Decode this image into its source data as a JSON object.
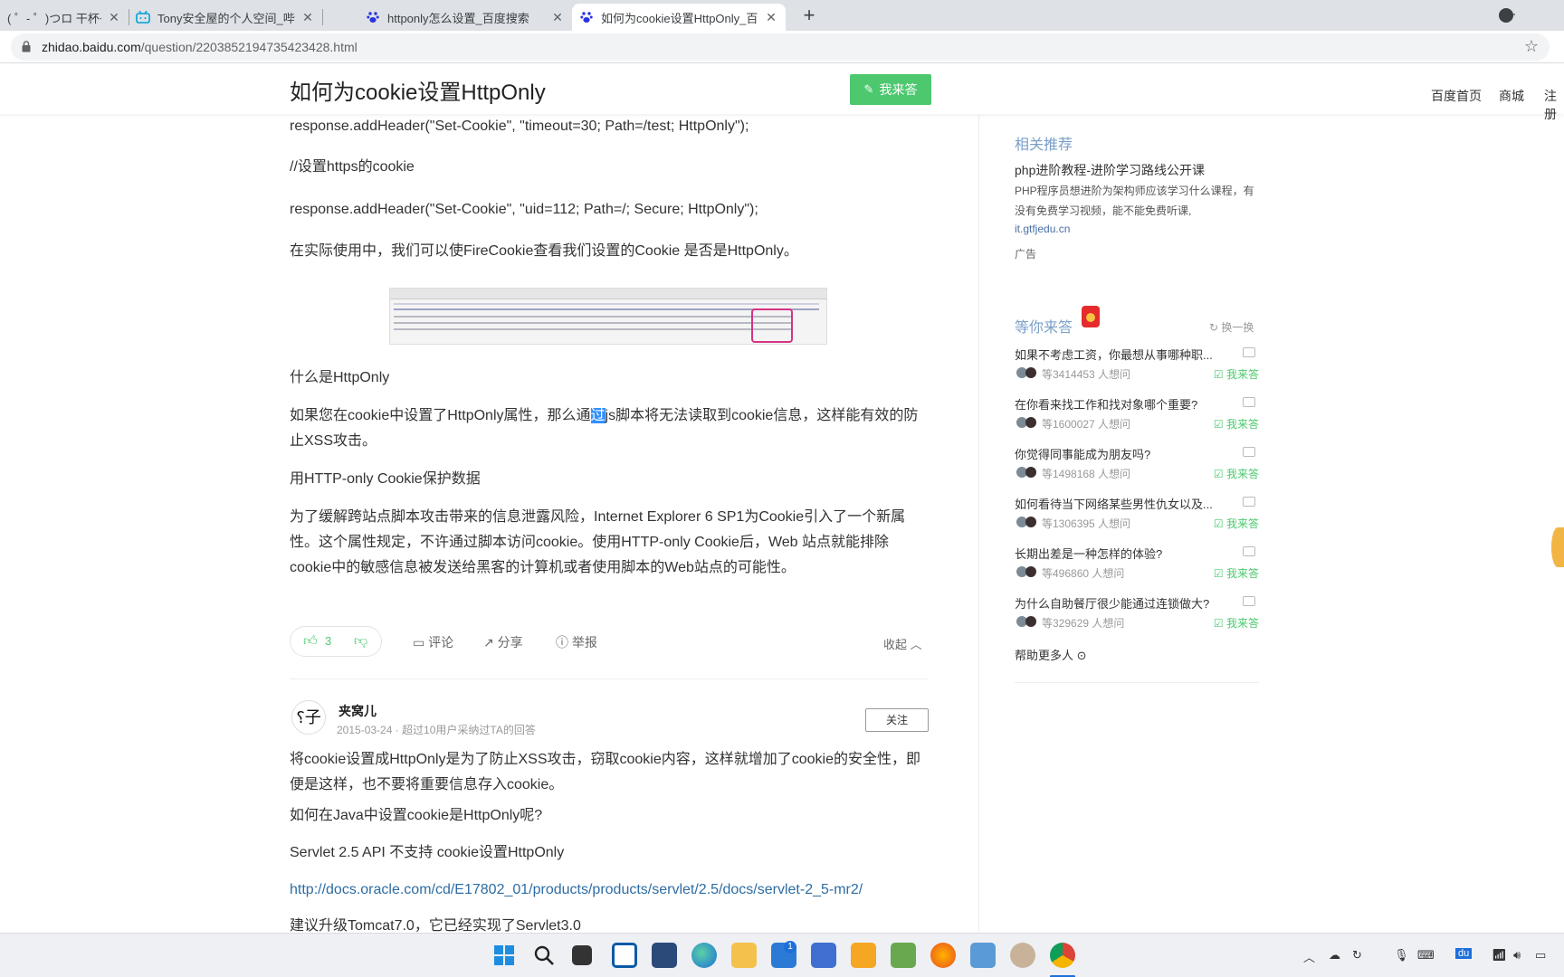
{
  "browser": {
    "tabs": [
      {
        "title": "( ゜- ゜)つロ 干杯~-bili",
        "favicon": "bilibili-icon"
      },
      {
        "title": "Tony安全屋的个人空间_哔哩哔哩",
        "favicon": "bilibili-tv-icon"
      },
      {
        "title": "httponly怎么设置_百度搜索",
        "favicon": "baidu-paw-icon"
      },
      {
        "title": "如何为cookie设置HttpOnly_百度",
        "favicon": "baidu-paw-icon"
      }
    ],
    "new_tab": "+",
    "close": "✕",
    "url_host": "zhidao.baidu.com",
    "url_path": "/question/2203852194735423428.html"
  },
  "header": {
    "question_title": "如何为cookie设置HttpOnly",
    "answer_button": "我来答",
    "nav": [
      "百度首页",
      "商城",
      "注册"
    ]
  },
  "answer1": {
    "paragraphs": [
      "response.addHeader(\"Set-Cookie\", \"timeout=30; Path=/test; HttpOnly\");",
      "//设置https的cookie",
      "response.addHeader(\"Set-Cookie\", \"uid=112; Path=/; Secure; HttpOnly\");",
      "在实际使用中，我们可以使FireCookie查看我们设置的Cookie 是否是HttpOnly。",
      "什么是HttpOnly",
      "用HTTP-only Cookie保护数据",
      "为了缓解跨站点脚本攻击带来的信息泄露风险，Internet Explorer 6 SP1为Cookie引入了一个新属性。这个属性规定，不许通过脚本访问cookie。使用HTTP-only Cookie后，Web 站点就能排除cookie中的敏感信息被发送给黑客的计算机或者使用脚本的Web站点的可能性。"
    ],
    "selected_para": {
      "before": "如果您在cookie中设置了HttpOnly属性，那么通",
      "selected": "过",
      "after": "js脚本将无法读取到cookie信息，这样能有效的防止XSS攻击。"
    },
    "like_count": "3",
    "comment": "评论",
    "share": "分享",
    "report": "举报",
    "collapse": "收起"
  },
  "answer2": {
    "avatar_text": "⸮子",
    "user_name": "夹窝儿",
    "meta": "2015-03-24 · 超过10用户采纳过TA的回答",
    "follow": "关注",
    "paragraphs": [
      "将cookie设置成HttpOnly是为了防止XSS攻击，窃取cookie内容，这样就增加了cookie的安全性，即便是这样，也不要将重要信息存入cookie。",
      "如何在Java中设置cookie是HttpOnly呢?",
      "Servlet 2.5 API 不支持 cookie设置HttpOnly"
    ],
    "link": "http://docs.oracle.com/cd/E17802_01/products/products/servlet/2.5/docs/servlet-2_5-mr2/",
    "cut_text": "建议升级Tomcat7.0，它已经实现了Servlet3.0"
  },
  "sidebar": {
    "related_title": "相关推荐",
    "ad": {
      "title": "php进阶教程-进阶学习路线公开课",
      "desc": "PHP程序员想进阶为架构师应该学习什么课程，有没有免费学习视频，能不能免费听课,",
      "link": "it.gtfjedu.cn",
      "tag": "广告"
    },
    "waiting_title": "等你来答",
    "refresh": "换一换",
    "questions": [
      {
        "title": "如果不考虑工资，你最想从事哪种职...",
        "waiting": "等3414453 人想问"
      },
      {
        "title": "在你看来找工作和找对象哪个重要?",
        "waiting": "等1600027 人想问"
      },
      {
        "title": "你觉得同事能成为朋友吗?",
        "waiting": "等1498168 人想问"
      },
      {
        "title": "如何看待当下网络某些男性仇女以及...",
        "waiting": "等1306395 人想问"
      },
      {
        "title": "长期出差是一种怎样的体验?",
        "waiting": "等496860 人想问"
      },
      {
        "title": "为什么自助餐厅很少能通过连锁做大?",
        "waiting": "等329629 人想问"
      }
    ],
    "answer_label": "我来答",
    "help_more": "帮助更多人"
  },
  "taskbar": {
    "mail_badge": "1",
    "ime": "du"
  },
  "colors": {
    "green": "#4dc86f",
    "blue_select": "#3390ff",
    "link": "#2e6da4"
  }
}
